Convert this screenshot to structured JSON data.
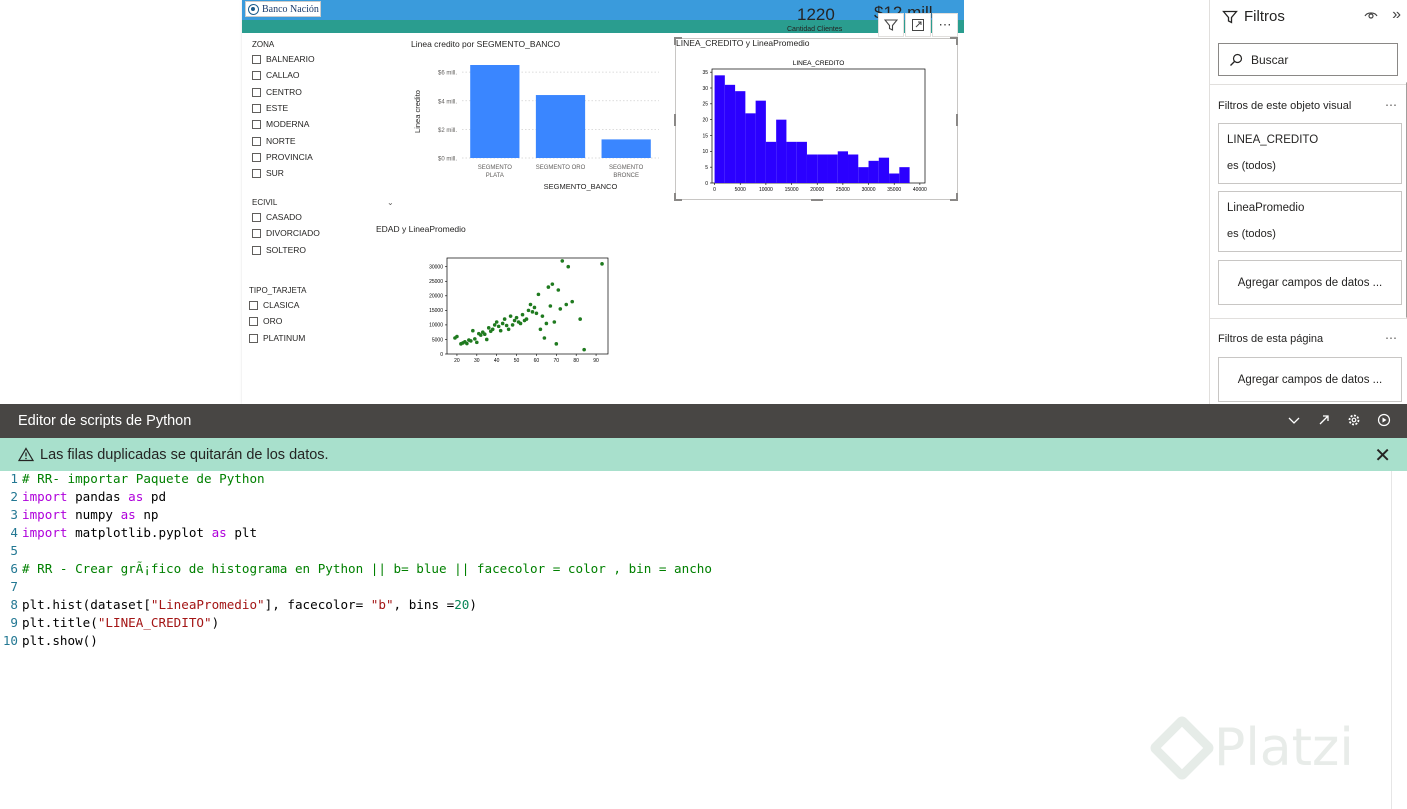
{
  "report": {
    "logo_text": "Banco Nación",
    "kpi1_value": "1220",
    "kpi1_label": "Cantidad Clientes",
    "kpi2_value": "$12 mill."
  },
  "slicers": {
    "zona": {
      "title": "ZONA",
      "items": [
        "BALNEARIO",
        "CALLAO",
        "CENTRO",
        "ESTE",
        "MODERNA",
        "NORTE",
        "PROVINCIA",
        "SUR"
      ]
    },
    "ecivil": {
      "title": "ECIVIL",
      "items": [
        "CASADO",
        "DIVORCIADO",
        "SOLTERO"
      ]
    },
    "tipo_tarjeta": {
      "title": "TIPO_TARJETA",
      "items": [
        "CLASICA",
        "ORO",
        "PLATINUM"
      ]
    }
  },
  "viz_titles": {
    "bar": "Linea credito por SEGMENTO_BANCO",
    "hist": "LINEA_CREDITO y LineaPromedio",
    "scatter": "EDAD y LineaPromedio"
  },
  "chart_data": [
    {
      "type": "bar",
      "title": "",
      "xlabel": "SEGMENTO_BANCO",
      "ylabel": "Linea credito",
      "categories": [
        "SEGMENTO PLATA",
        "SEGMENTO ORO",
        "SEGMENTO BRONCE"
      ],
      "values": [
        6.5,
        4.4,
        1.3
      ],
      "ylim": [
        0,
        6.5
      ],
      "ytick_labels": [
        "$0 mill.",
        "$2 mill.",
        "$4 mill.",
        "$6 mill."
      ],
      "color": "#3a86ff"
    },
    {
      "type": "bar",
      "title": "LINEA_CREDITO",
      "bin_edges": [
        0,
        2000,
        4000,
        6000,
        8000,
        10000,
        12000,
        14000,
        16000,
        18000,
        20000,
        22000,
        24000,
        26000,
        28000,
        30000,
        32000,
        34000,
        36000,
        38000,
        40000
      ],
      "values": [
        34,
        31,
        29,
        22,
        26,
        13,
        20,
        13,
        13,
        9,
        9,
        9,
        10,
        9,
        5,
        7,
        8,
        3,
        5,
        0
      ],
      "xticks": [
        0,
        5000,
        10000,
        15000,
        20000,
        25000,
        30000,
        35000,
        40000
      ],
      "yticks": [
        0,
        5,
        10,
        15,
        20,
        25,
        30,
        35
      ],
      "xlim": [
        -500,
        41000
      ],
      "ylim": [
        0,
        36
      ],
      "color": "#2b00ff"
    },
    {
      "type": "scatter",
      "title": "",
      "x": [
        19,
        20,
        22,
        23,
        24,
        25,
        26,
        27,
        28,
        29,
        30,
        31,
        32,
        33,
        34,
        35,
        36,
        37,
        38,
        39,
        40,
        41,
        42,
        43,
        44,
        45,
        46,
        47,
        48,
        49,
        50,
        51,
        52,
        53,
        54,
        55,
        56,
        57,
        58,
        59,
        60,
        61,
        62,
        63,
        64,
        65,
        66,
        67,
        68,
        69,
        70,
        71,
        72,
        73,
        75,
        76,
        78,
        82,
        84,
        93
      ],
      "y": [
        5500,
        6000,
        3500,
        3800,
        4200,
        3600,
        4800,
        4500,
        8000,
        5200,
        4000,
        7000,
        6500,
        7500,
        6800,
        5000,
        9000,
        7800,
        8500,
        10000,
        11000,
        9500,
        8000,
        10500,
        12000,
        9800,
        8500,
        13000,
        10000,
        11500,
        12500,
        11000,
        10500,
        13500,
        11500,
        12000,
        15000,
        17000,
        14500,
        16000,
        14000,
        20500,
        8500,
        13000,
        5500,
        10500,
        23000,
        16500,
        24000,
        11000,
        3500,
        22000,
        15500,
        32000,
        17000,
        30000,
        18000,
        12000,
        1500,
        31000
      ],
      "xticks": [
        20,
        30,
        40,
        50,
        60,
        70,
        80,
        90
      ],
      "yticks": [
        0,
        5000,
        10000,
        15000,
        20000,
        25000,
        30000
      ],
      "xlim": [
        15,
        96
      ],
      "ylim": [
        0,
        33000
      ],
      "color": "#1f7a1f"
    }
  ],
  "filters": {
    "title": "Filtros",
    "search_placeholder": "Buscar",
    "section_visual": "Filtros de este objeto visual",
    "cards": [
      {
        "field": "LINEA_CREDITO",
        "value": "es (todos)"
      },
      {
        "field": "LineaPromedio",
        "value": "es (todos)"
      }
    ],
    "add_fields": "Agregar campos de datos ...",
    "section_page": "Filtros de esta página",
    "add_fields_page": "Agregar campos de datos ..."
  },
  "editor": {
    "title": "Editor de scripts de Python",
    "warning": "Las filas duplicadas se quitarán de los datos.",
    "line_numbers": [
      "1",
      "2",
      "3",
      "4",
      "5",
      "6",
      "7",
      "8",
      "9",
      "10"
    ],
    "code": {
      "l1": "# RR- importar Paquete de Python",
      "l2a": "import",
      "l2b": " pandas ",
      "l2c": "as",
      "l2d": " pd",
      "l3a": "import",
      "l3b": " numpy ",
      "l3c": "as",
      "l3d": " np",
      "l4a": "import",
      "l4b": " matplotlib.pyplot ",
      "l4c": "as",
      "l4d": " plt",
      "l6": "# RR - Crear grÃ¡fico de histograma en Python || b= blue || facecolor = color , bin = ancho",
      "l8a": "plt.hist(dataset[",
      "l8b": "\"LineaPromedio\"",
      "l8c": "], facecolor= ",
      "l8d": "\"b\"",
      "l8e": ", bins =",
      "l8f": "20",
      "l8g": ")",
      "l9a": "plt.title(",
      "l9b": "\"LINEA_CREDITO\"",
      "l9c": ")",
      "l10": "plt.show()"
    }
  },
  "watermark": "Platzi",
  "colors": {
    "header_blue": "#3a9bdc",
    "header_green": "#2a9d8f",
    "warning_bg": "#a8e0cc",
    "editor_bar": "#484644"
  }
}
